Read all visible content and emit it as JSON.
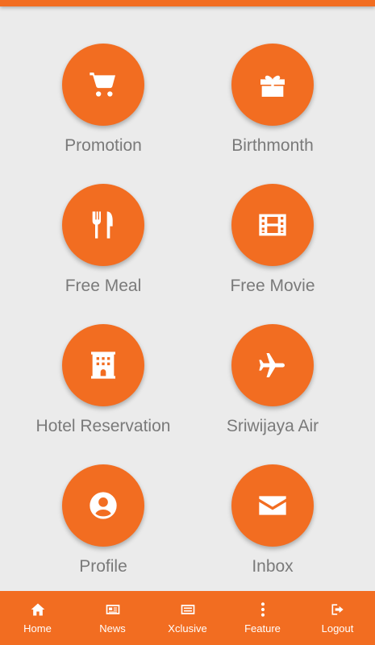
{
  "menu": [
    {
      "label": "Promotion",
      "icon": "cart-icon"
    },
    {
      "label": "Birthmonth",
      "icon": "gift-icon"
    },
    {
      "label": "Free Meal",
      "icon": "utensils-icon"
    },
    {
      "label": "Free Movie",
      "icon": "film-icon"
    },
    {
      "label": "Hotel Reservation",
      "icon": "hotel-icon"
    },
    {
      "label": "Sriwijaya Air",
      "icon": "airplane-icon"
    },
    {
      "label": "Profile",
      "icon": "user-circle-icon"
    },
    {
      "label": "Inbox",
      "icon": "envelope-icon"
    }
  ],
  "nav": [
    {
      "label": "Home",
      "icon": "home-icon"
    },
    {
      "label": "News",
      "icon": "newspaper-icon"
    },
    {
      "label": "Xclusive",
      "icon": "list-card-icon"
    },
    {
      "label": "Feature",
      "icon": "more-vertical-icon"
    },
    {
      "label": "Logout",
      "icon": "logout-icon"
    }
  ],
  "colors": {
    "accent": "#f26d21",
    "background": "#ebebeb",
    "label": "#7a7a7a"
  }
}
